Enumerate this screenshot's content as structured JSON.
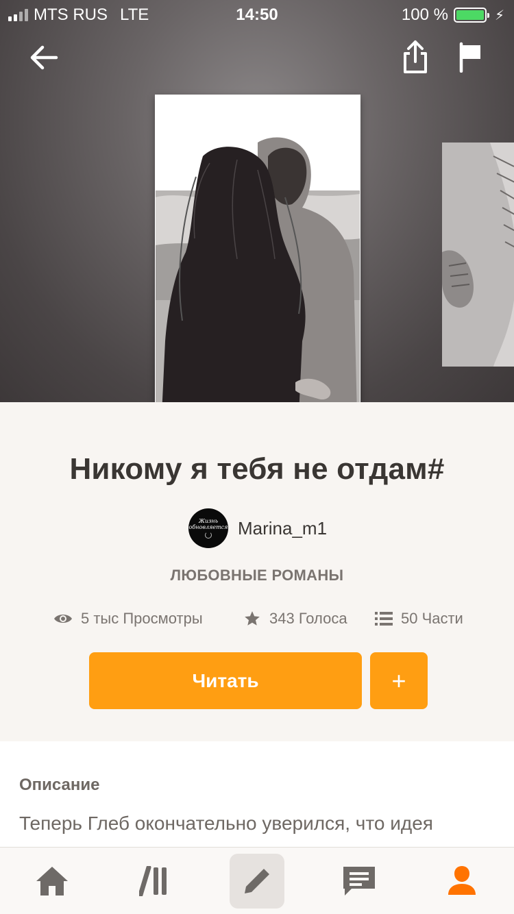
{
  "status_bar": {
    "carrier": "MTS RUS",
    "network": "LTE",
    "time": "14:50",
    "battery": "100 %",
    "battery_level": 1.0
  },
  "header": {
    "back_icon": "arrow-left-icon",
    "share_icon": "share-icon",
    "report_icon": "flag-icon"
  },
  "story": {
    "title": "Никому я тебя не отдам#",
    "author": {
      "name": "Marina_m1",
      "avatar_text_line1": "Жизнь",
      "avatar_text_line2": "обновляется"
    },
    "genre": "ЛЮБОВНЫЕ РОМАНЫ",
    "stats": {
      "views": "5 тыс Просмотры",
      "votes": "343 Голоса",
      "parts": "50 Части"
    }
  },
  "actions": {
    "read_label": "Читать",
    "add_label": "+"
  },
  "description": {
    "heading": "Описание",
    "text": "Теперь Глеб окончательно уверился, что идея"
  },
  "tabbar": {
    "items": [
      {
        "name": "home",
        "icon": "home-icon"
      },
      {
        "name": "library",
        "icon": "library-icon"
      },
      {
        "name": "write",
        "icon": "pencil-icon",
        "active": true
      },
      {
        "name": "messages",
        "icon": "chat-icon"
      },
      {
        "name": "profile",
        "icon": "profile-icon"
      }
    ]
  },
  "colors": {
    "accent": "#ff9e12",
    "profile_tab": "#ff7300",
    "text_primary": "#3a3633",
    "text_secondary": "#7a7470",
    "battery_green": "#4cd964"
  }
}
